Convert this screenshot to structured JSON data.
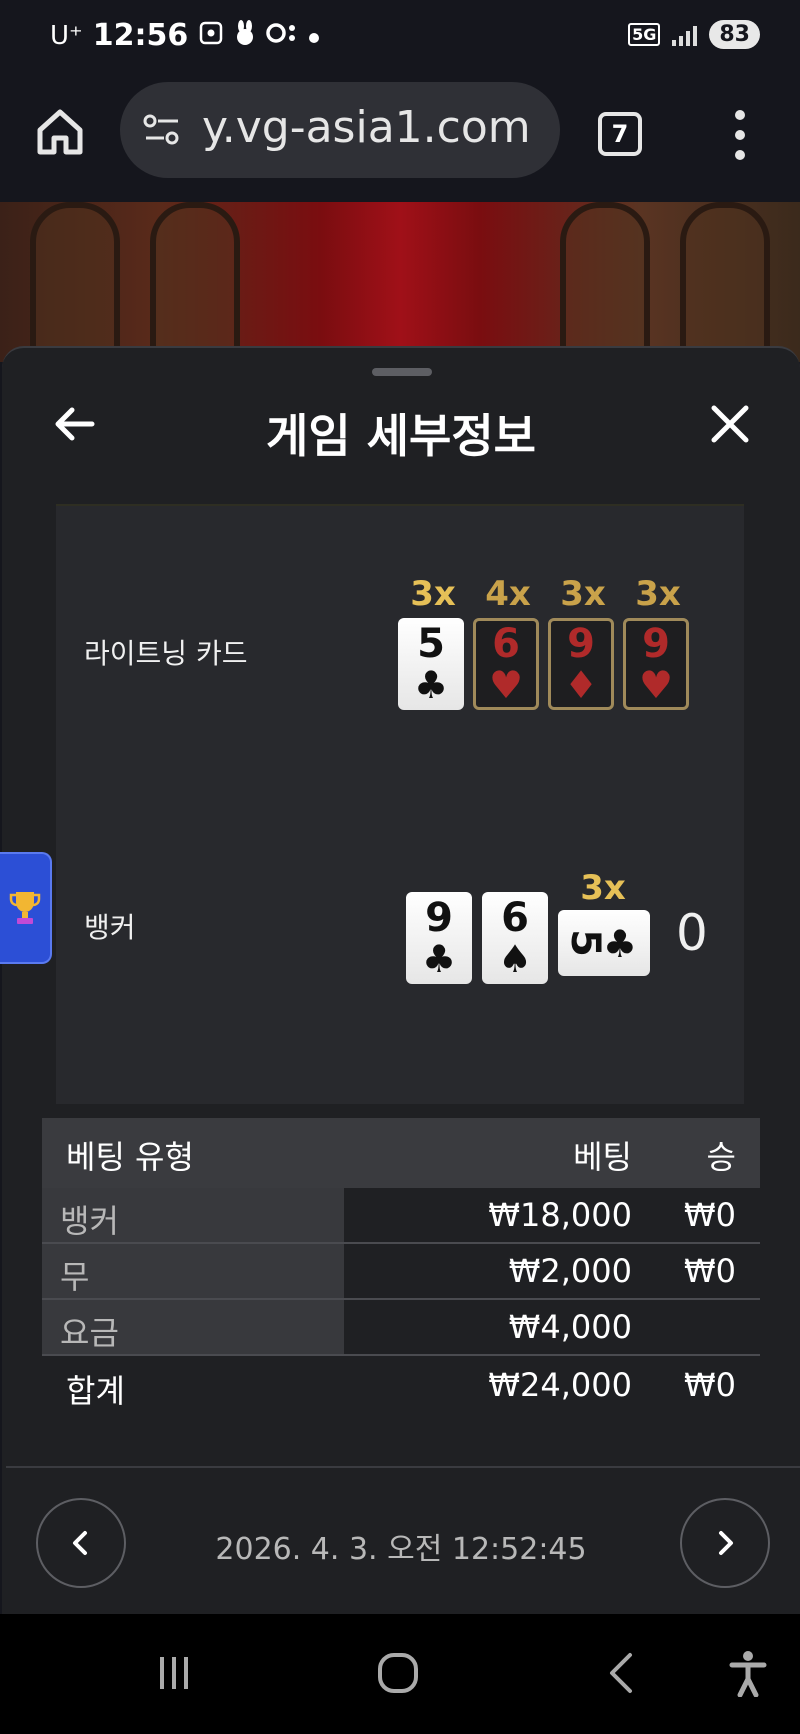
{
  "status_bar": {
    "carrier": "U⁺",
    "time": "12:56",
    "network": "5G",
    "battery": "83"
  },
  "browser": {
    "url": "y.vg-asia1.com",
    "tab_count": "7"
  },
  "panel": {
    "title": "게임 세부정보"
  },
  "lightning": {
    "label": "라이트닝 카드",
    "cards": [
      {
        "multiplier": "3x",
        "rank": "5",
        "suit": "♣"
      },
      {
        "multiplier": "4x",
        "rank": "6",
        "suit": "♥"
      },
      {
        "multiplier": "3x",
        "rank": "9",
        "suit": "♦"
      },
      {
        "multiplier": "3x",
        "rank": "9",
        "suit": "♥"
      }
    ]
  },
  "banker": {
    "label": "뱅커",
    "cards": [
      {
        "rank": "9",
        "suit": "♣"
      },
      {
        "rank": "6",
        "suit": "♠"
      },
      {
        "rank": "5",
        "suit": "♣",
        "multiplier": "3x"
      }
    ],
    "score": "0"
  },
  "bets": {
    "header": {
      "type": "베팅 유형",
      "bet": "베팅",
      "win": "승"
    },
    "rows": [
      {
        "type": "뱅커",
        "bet": "₩18,000",
        "win": "₩0"
      },
      {
        "type": "무",
        "bet": "₩2,000",
        "win": "₩0"
      },
      {
        "type": "요금",
        "bet": "₩4,000",
        "win": ""
      }
    ],
    "total": {
      "label": "합계",
      "bet": "₩24,000",
      "win": "₩0"
    }
  },
  "footer": {
    "datetime": "2026. 4. 3. 오전 12:52:45"
  },
  "colors": {
    "gold": "#c9a24a",
    "panel_bg": "#1f2023",
    "accent_blue": "#2c4fd6"
  }
}
